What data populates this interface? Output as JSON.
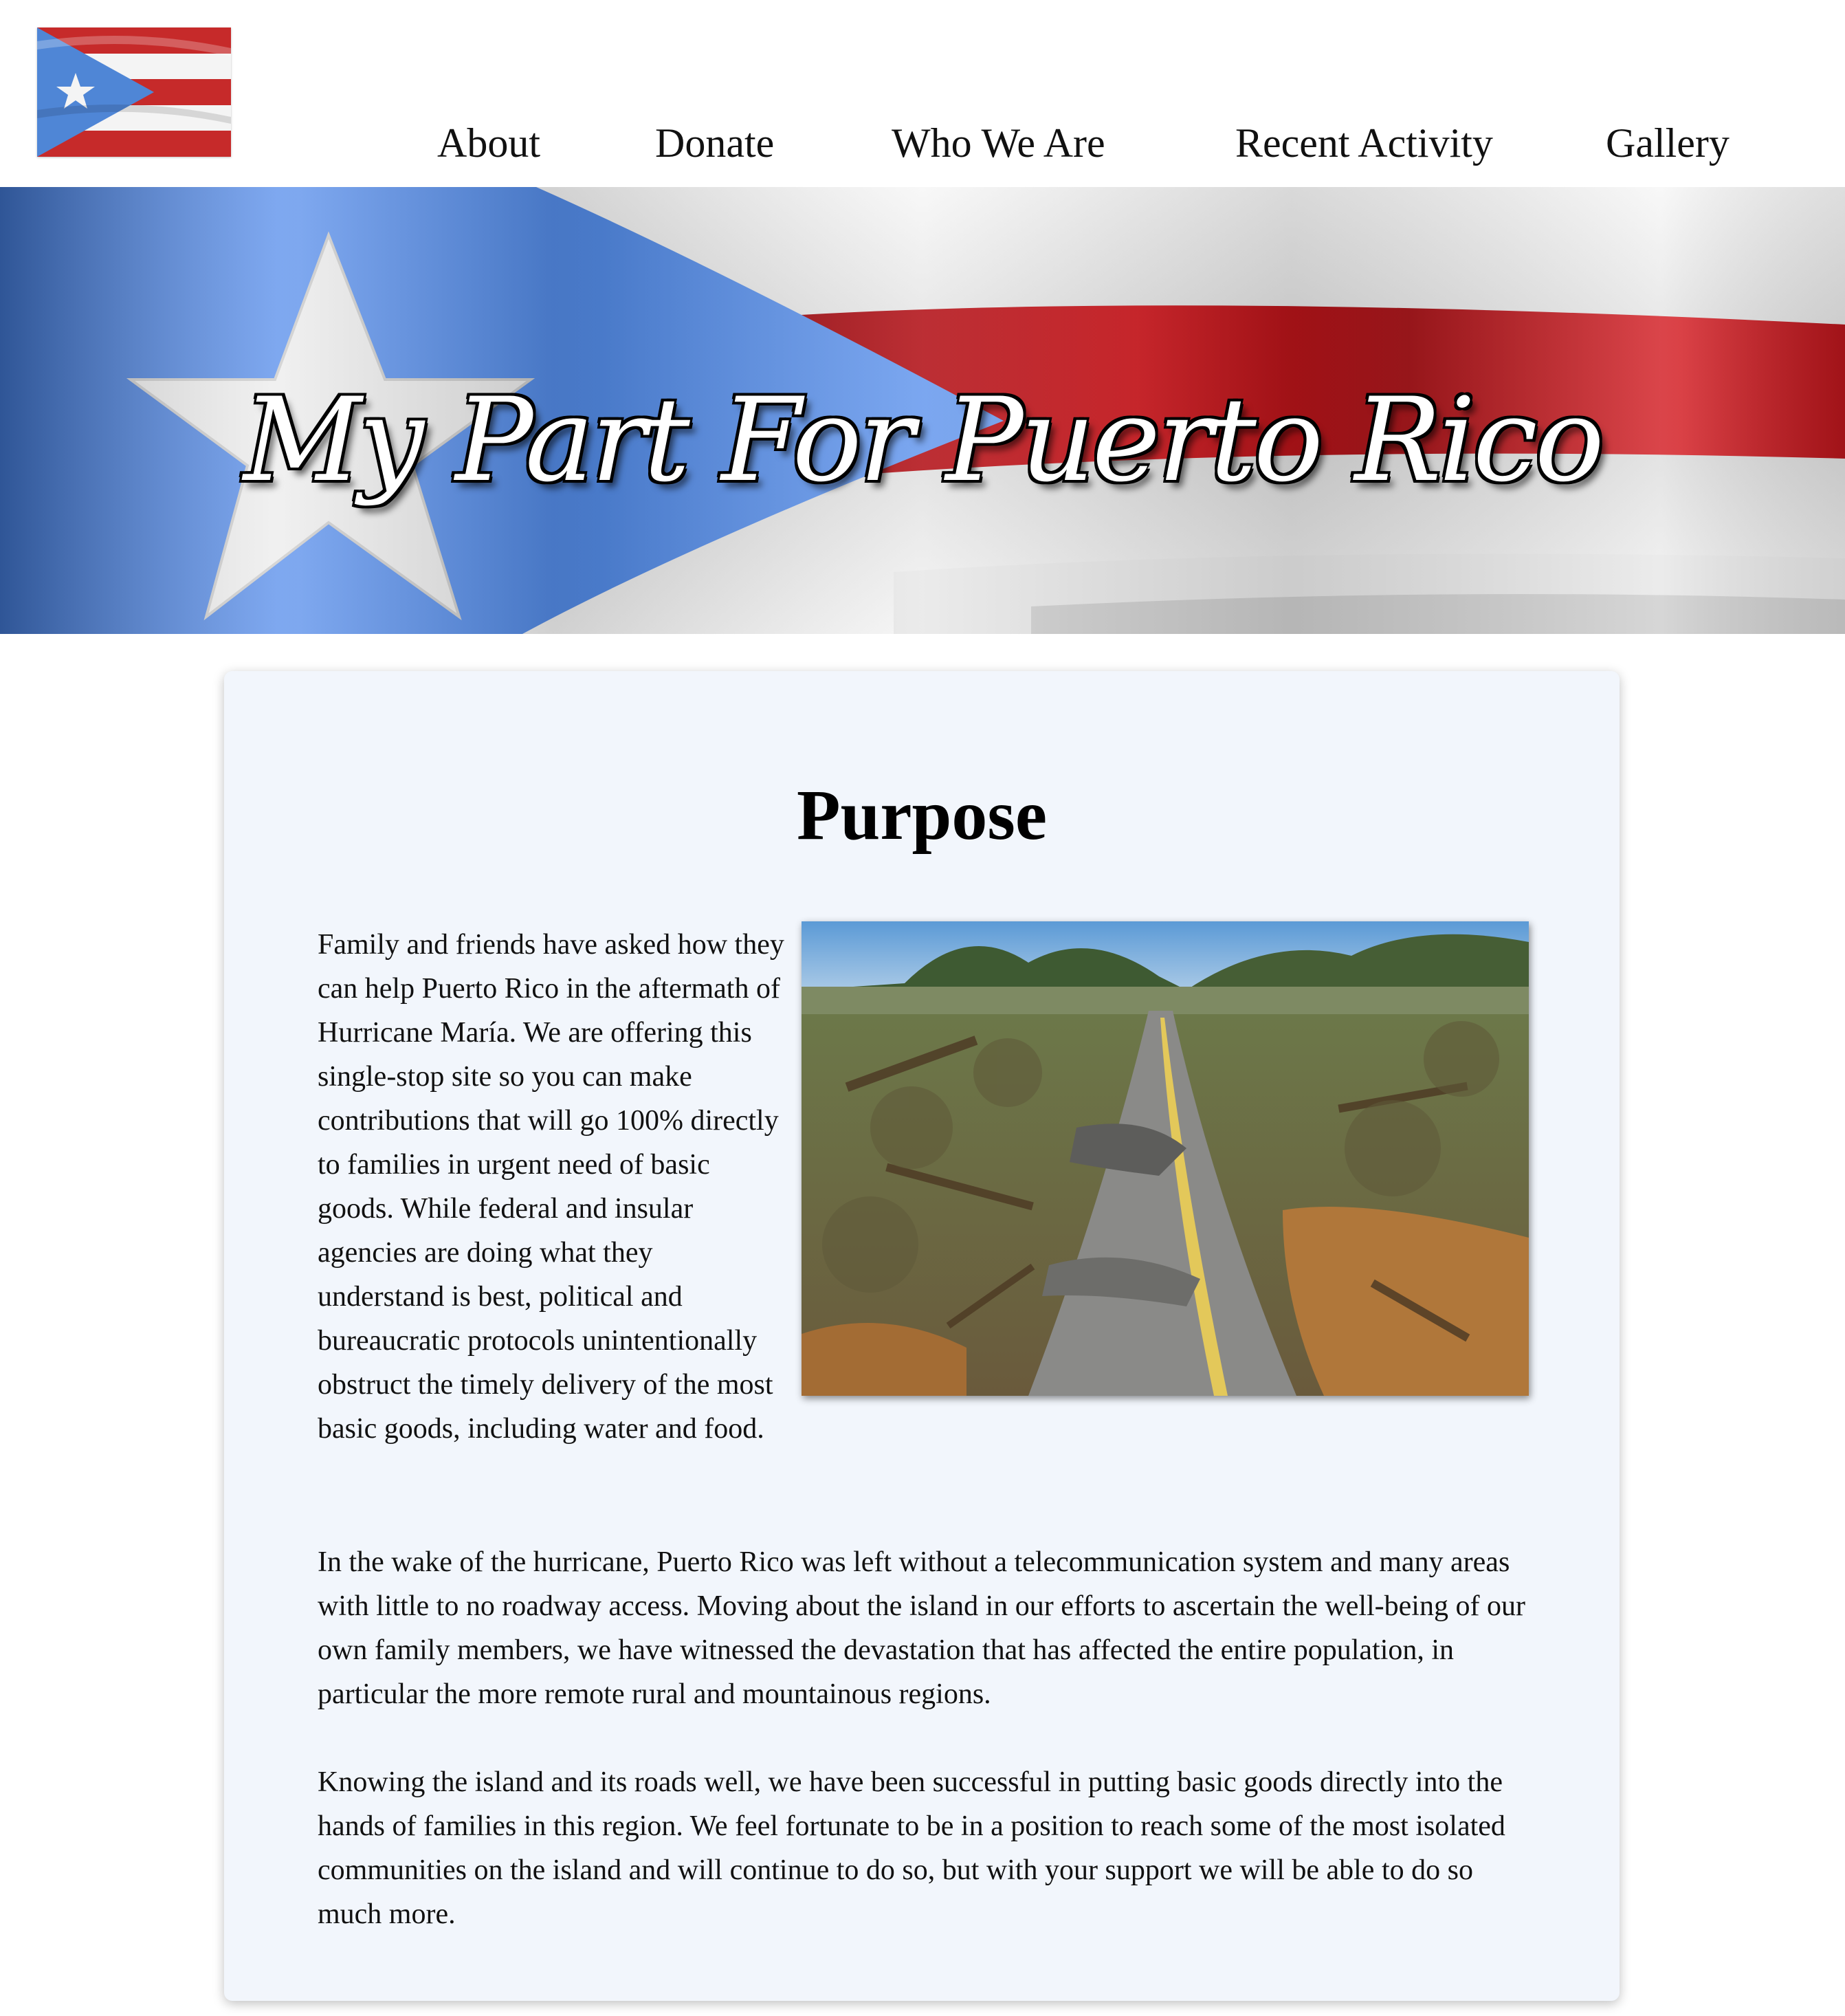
{
  "nav": {
    "items": [
      {
        "label": "About"
      },
      {
        "label": "Donate"
      },
      {
        "label": "Who We Are"
      },
      {
        "label": "Recent Activity"
      },
      {
        "label": "Gallery"
      }
    ]
  },
  "banner": {
    "title": "My Part For Puerto Rico"
  },
  "purpose": {
    "heading": "Purpose",
    "paragraphs": [
      "Family and friends have asked how they can help Puerto Rico in the aftermath of Hurricane María. We are offering this single-stop site so you can make contributions that will go 100% directly to families in urgent need of basic goods. While federal and insular agencies are doing what they understand is best, political and bureaucratic protocols unintentionally obstruct the timely delivery of the most basic goods, including water and food.",
      "In the wake of the hurricane, Puerto Rico was left without a telecommunication system and many areas with little to no roadway access. Moving about the island in our efforts to ascertain the well-being of our own family members, we have witnessed the devastation that has affected the entire population, in particular the more remote rural and mountainous regions.",
      "Knowing the island and its roads well, we have been successful in putting basic goods directly into the hands of families in this region. We feel fortunate to be in a position to reach some of the most isolated communities on the island and will continue to do so, but with your support we will be able to do so much more."
    ]
  },
  "colors": {
    "flag_blue": "#5a8ee0",
    "flag_red": "#c4161c",
    "card_bg": "#f2f6fc"
  }
}
